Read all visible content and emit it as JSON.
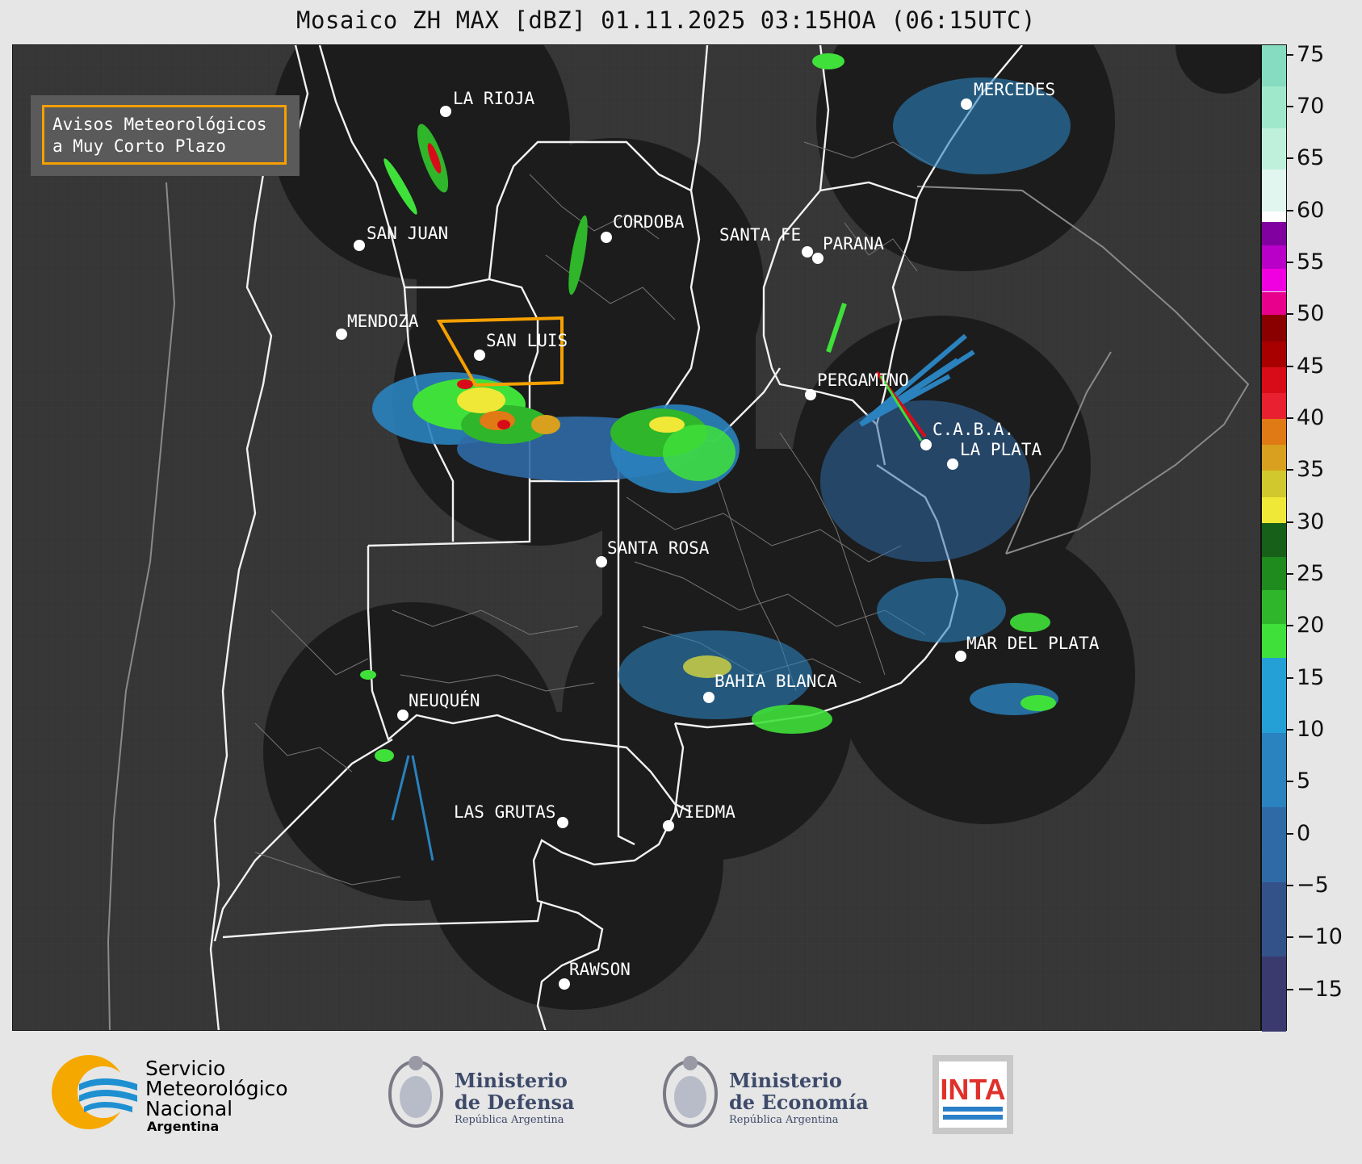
{
  "title": "Mosaico ZH MAX [dBZ] 01.11.2025 03:15HOA (06:15UTC)",
  "warning_box": {
    "line1": "Avisos Meteorológicos",
    "line2": "a Muy Corto Plazo"
  },
  "cities": [
    {
      "name": "LA RIOJA"
    },
    {
      "name": "MERCEDES"
    },
    {
      "name": "SAN JUAN"
    },
    {
      "name": "CORDOBA"
    },
    {
      "name": "SANTA FE"
    },
    {
      "name": "PARANA"
    },
    {
      "name": "MENDOZA"
    },
    {
      "name": "SAN LUIS"
    },
    {
      "name": "PERGAMINO"
    },
    {
      "name": "C.A.B.A."
    },
    {
      "name": "LA PLATA"
    },
    {
      "name": "SANTA ROSA"
    },
    {
      "name": "MAR DEL PLATA"
    },
    {
      "name": "BAHIA BLANCA"
    },
    {
      "name": "NEUQUÉN"
    },
    {
      "name": "LAS GRUTAS"
    },
    {
      "name": "VIEDMA"
    },
    {
      "name": "RAWSON"
    }
  ],
  "colorbar": {
    "unit": "dBZ",
    "min": -19,
    "max": 76,
    "ticks": [
      "75",
      "70",
      "65",
      "60",
      "55",
      "50",
      "45",
      "40",
      "35",
      "30",
      "25",
      "20",
      "15",
      "10",
      "5",
      "0",
      "−5",
      "−10",
      "−15"
    ],
    "tick_values": [
      75,
      70,
      65,
      60,
      55,
      50,
      45,
      40,
      35,
      30,
      25,
      20,
      15,
      10,
      5,
      0,
      -5,
      -10,
      -15
    ],
    "bands": [
      {
        "from": -19,
        "to": 17,
        "colors": [
          "#3a3a6e",
          "#34528a",
          "#2f6aa6",
          "#2a82be",
          "#25a0d6"
        ]
      },
      {
        "from": 17,
        "to": 30,
        "colors": [
          "#3fe03a",
          "#2fb62a",
          "#1f8a1e",
          "#17601a"
        ]
      },
      {
        "from": 30,
        "to": 40,
        "colors": [
          "#f0e836",
          "#d0c82c",
          "#d8a01e",
          "#e07a14"
        ]
      },
      {
        "from": 40,
        "to": 50,
        "colors": [
          "#e82030",
          "#d80c18",
          "#a80000",
          "#8a0000"
        ]
      },
      {
        "from": 50,
        "to": 59,
        "colors": [
          "#e8008c",
          "#f000e0",
          "#b800c8",
          "#8000a0"
        ]
      },
      {
        "from": 59,
        "to": 60,
        "colors": [
          "#ffffff"
        ]
      },
      {
        "from": 60,
        "to": 76,
        "colors": [
          "#e0f6ee",
          "#bff0dc",
          "#a0e8cc",
          "#86dcc0"
        ]
      }
    ]
  },
  "logos": {
    "smn": {
      "line1": "Servicio",
      "line2": "Meteorológico",
      "line3": "Nacional",
      "line4": "Argentina"
    },
    "defensa": {
      "line1": "Ministerio",
      "line2": "de Defensa",
      "line3": "República Argentina"
    },
    "economia": {
      "line1": "Ministerio",
      "line2": "de Economía",
      "line3": "República Argentina"
    },
    "inta": {
      "label": "INTA"
    }
  }
}
